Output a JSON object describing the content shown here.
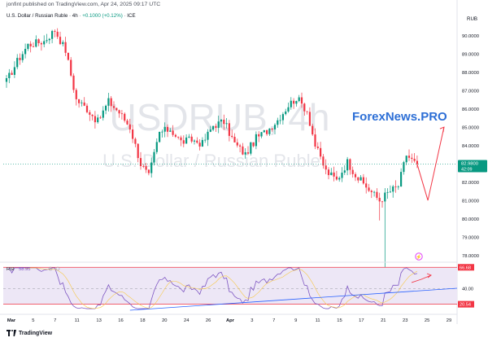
{
  "header": {
    "published_line": "jonfint published on TradingView.com, Apr 24, 2025 09:17 UTC",
    "symbol_name": "U.S. Dollar / Russian Ruble · 4h",
    "change_text": "+0.1000 (+0.12%)",
    "exchange": "ICE",
    "currency": "RUB"
  },
  "watermark": {
    "ticker": "USDRUB, 4h",
    "name": "U.S. Dollar / Russian Ruble"
  },
  "brand_text": "ForexNews.PRO",
  "footer": {
    "logo_text": "TradingView"
  },
  "price_badge": {
    "price": "82.9800",
    "countdown": "42:09"
  },
  "rsi_indicator": {
    "label": "RSI",
    "value": "58.95",
    "upper_badge": "66.68",
    "lower_badge": "20.54",
    "mid_label": "40.00"
  },
  "colors": {
    "up": "#089981",
    "down": "#f23645",
    "rsi_line": "#7e57c2",
    "rsi_band": "#ede7f6",
    "trendline": "#2962ff",
    "forecast": "#f23645",
    "brand": "#2d6fd6",
    "last_price": "#089981"
  },
  "chart_data": {
    "type": "candlestick",
    "title": "USDRUB, 4h",
    "interval": "4h",
    "price_axis_ticks": [
      "90.0000",
      "89.0000",
      "88.0000",
      "87.0000",
      "86.0000",
      "85.0000",
      "84.0000",
      "83.0000",
      "82.0000",
      "81.0000",
      "80.0000",
      "79.0000",
      "78.0000"
    ],
    "ylim": [
      77.8,
      90.7
    ],
    "time_axis_labels": [
      "Mar",
      "5",
      "7",
      "11",
      "13",
      "16",
      "18",
      "20",
      "24",
      "26",
      "Apr",
      "3",
      "7",
      "9",
      "11",
      "15",
      "17",
      "21",
      "23",
      "25",
      "29"
    ],
    "last_price": 82.98,
    "series": [
      {
        "name": "USDRUB",
        "anchors": [
          [
            0,
            87.5
          ],
          [
            4,
            88.6
          ],
          [
            8,
            89.5
          ],
          [
            14,
            89.7
          ],
          [
            18,
            90.3
          ],
          [
            22,
            89.2
          ],
          [
            26,
            86.5
          ],
          [
            30,
            86.0
          ],
          [
            34,
            85.3
          ],
          [
            38,
            86.4
          ],
          [
            42,
            85.8
          ],
          [
            46,
            85.0
          ],
          [
            50,
            83.0
          ],
          [
            53,
            82.3
          ],
          [
            57,
            84.7
          ],
          [
            61,
            84.9
          ],
          [
            65,
            84.2
          ],
          [
            69,
            84.3
          ],
          [
            73,
            84.1
          ],
          [
            77,
            85.1
          ],
          [
            81,
            85.3
          ],
          [
            85,
            84.1
          ],
          [
            89,
            83.5
          ],
          [
            93,
            84.4
          ],
          [
            97,
            84.8
          ],
          [
            101,
            85.4
          ],
          [
            105,
            86.2
          ],
          [
            108,
            86.6
          ],
          [
            112,
            85.9
          ],
          [
            115,
            84.0
          ],
          [
            119,
            82.6
          ],
          [
            123,
            82.1
          ],
          [
            127,
            83.1
          ],
          [
            131,
            82.2
          ],
          [
            135,
            81.6
          ],
          [
            139,
            81.0
          ],
          [
            142,
            81.4
          ],
          [
            146,
            81.8
          ],
          [
            149,
            83.5
          ],
          [
            153,
            82.9
          ]
        ]
      }
    ],
    "rsi": {
      "upper_level": 66.68,
      "middle_level": 40.0,
      "lower_level": 20.54,
      "last_value": 58.95
    },
    "annotations": {
      "forecast_path": [
        [
          153,
          82.98
        ],
        [
          157,
          81.0
        ],
        [
          163,
          85.0
        ]
      ],
      "pivot_low": 77.3
    }
  }
}
